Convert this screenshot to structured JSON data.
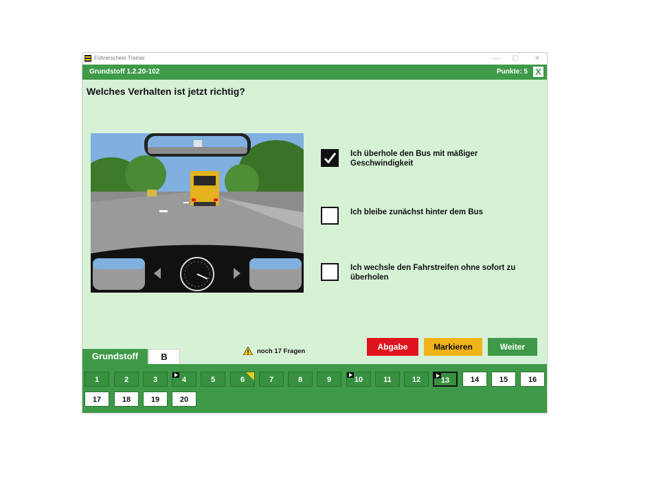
{
  "window": {
    "title": "Führerschein Trainer",
    "controls": [
      "—",
      "☐",
      "✕"
    ]
  },
  "header": {
    "version": "Grundstoff 1.2.20-102",
    "points": "Punkte: 5",
    "close": "X"
  },
  "question": "Welches Verhalten ist jetzt richtig?",
  "answers": [
    {
      "text": "Ich überhole den Bus mit mäßiger Geschwindigkeit",
      "checked": true
    },
    {
      "text": "Ich bleibe zunächst hinter dem Bus",
      "checked": false
    },
    {
      "text": "Ich wechsle den Fahrstreifen ohne sofort zu überholen",
      "checked": false
    }
  ],
  "buttons": {
    "submit": "Abgabe",
    "mark": "Markieren",
    "next": "Weiter"
  },
  "buttons_colors": {
    "submit": "#e0141e",
    "mark": "#f0b418",
    "next": "#3e9a48"
  },
  "remaining": "noch 17 Fragen",
  "tabs": {
    "active": "Grundstoff",
    "inactive": "B"
  },
  "question_numbers": [
    {
      "label": "1",
      "state": "done"
    },
    {
      "label": "2",
      "state": "done"
    },
    {
      "label": "3",
      "state": "done"
    },
    {
      "label": "4",
      "state": "done",
      "flag": true
    },
    {
      "label": "5",
      "state": "done"
    },
    {
      "label": "6",
      "state": "done",
      "mark": true
    },
    {
      "label": "7",
      "state": "done"
    },
    {
      "label": "8",
      "state": "done"
    },
    {
      "label": "9",
      "state": "done"
    },
    {
      "label": "10",
      "state": "done",
      "flag": true
    },
    {
      "label": "11",
      "state": "done"
    },
    {
      "label": "12",
      "state": "done"
    },
    {
      "label": "13",
      "state": "current",
      "flag": true
    },
    {
      "label": "14",
      "state": "open"
    },
    {
      "label": "15",
      "state": "open"
    },
    {
      "label": "16",
      "state": "open"
    },
    {
      "label": "17",
      "state": "open"
    },
    {
      "label": "18",
      "state": "open"
    },
    {
      "label": "19",
      "state": "open"
    },
    {
      "label": "20",
      "state": "open"
    }
  ]
}
